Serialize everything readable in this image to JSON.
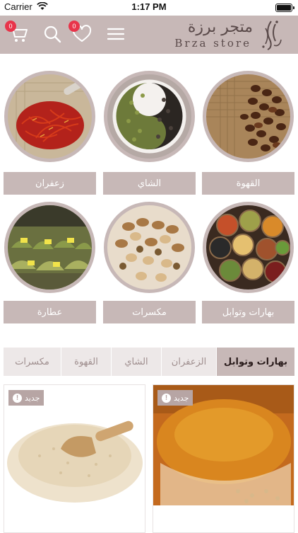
{
  "status_bar": {
    "carrier": "Carrier",
    "time": "1:17 PM"
  },
  "header": {
    "cart_count": "0",
    "wishlist_count": "0",
    "logo_arabic": "متجر برزة",
    "logo_english": "Brza store",
    "icons": [
      "cart-icon",
      "search-icon",
      "heart-icon",
      "menu-icon"
    ]
  },
  "categories": [
    {
      "label": "القهوة",
      "image": "coffee-beans"
    },
    {
      "label": "الشاي",
      "image": "green-and-black-tea"
    },
    {
      "label": "زعفران",
      "image": "saffron"
    },
    {
      "label": "بهارات وتوابل",
      "image": "spices-bowls"
    },
    {
      "label": "مكسرات",
      "image": "nuts"
    },
    {
      "label": "عطارة",
      "image": "herbal-market"
    }
  ],
  "tabs": [
    {
      "label": "بهارات وتوابل",
      "active": true
    },
    {
      "label": "الزعفران",
      "active": false
    },
    {
      "label": "الشاي",
      "active": false
    },
    {
      "label": "القهوة",
      "active": false
    },
    {
      "label": "مكسرات",
      "active": false
    }
  ],
  "products": [
    {
      "badge": "جديد",
      "image": "spice-powder-bowl"
    },
    {
      "badge": "جديد",
      "image": "sesame-seeds-scoop"
    }
  ],
  "colors": {
    "accent": "#c7b8b7",
    "badge_red": "#e8344a",
    "tab_bg": "#ede8e8"
  }
}
